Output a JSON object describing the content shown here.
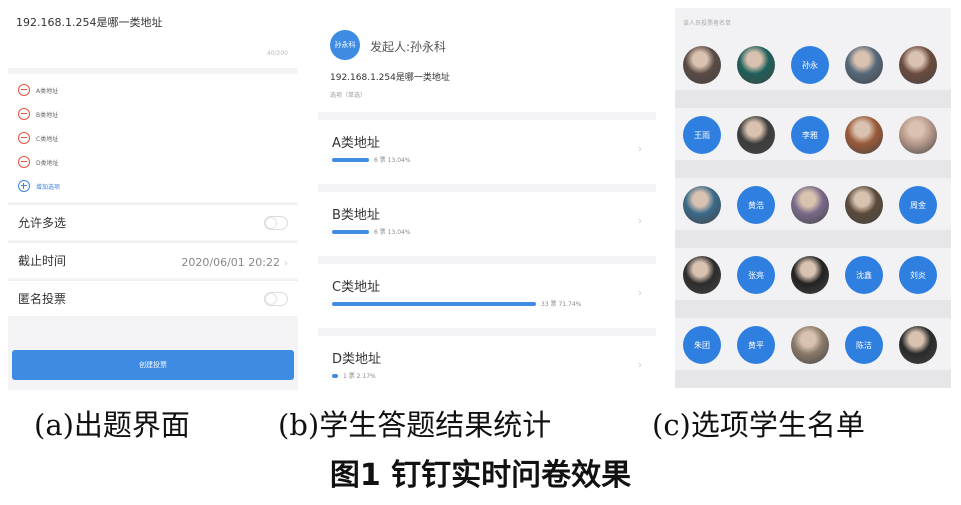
{
  "panel_a": {
    "question_title": "192.168.1.254是哪一类地址",
    "question_count": "40/200",
    "options": [
      "A类地址",
      "B类地址",
      "C类地址",
      "D类地址"
    ],
    "add_option": "增加选项",
    "settings": {
      "multi_select_label": "允许多选",
      "deadline_label": "截止时间",
      "deadline_value": "2020/06/01 20:22",
      "anonymous_label": "匿名投票"
    },
    "create_button": "创建投票"
  },
  "panel_b": {
    "avatar_text": "孙永科",
    "initiator": "发起人:孙永科",
    "question_title": "192.168.1.254是哪一类地址",
    "question_type": "选项（单选）",
    "results": [
      {
        "label": "A类地址",
        "votes": "6 票",
        "percent": "13.04%",
        "fraction": 0.13
      },
      {
        "label": "B类地址",
        "votes": "6 票",
        "percent": "13.04%",
        "fraction": 0.13
      },
      {
        "label": "C类地址",
        "votes": "33 票",
        "percent": "71.74%",
        "fraction": 0.72
      },
      {
        "label": "D类地址",
        "votes": "1 票",
        "percent": "2.17%",
        "fraction": 0.02
      }
    ]
  },
  "panel_c": {
    "header": "该人员投票者名单",
    "rows": [
      [
        {
          "photo": "#5a4a44"
        },
        {
          "photo": "#1e5f5a"
        },
        {
          "name": "孙永"
        },
        {
          "photo": "#55687a"
        },
        {
          "photo": "#6b4b3e"
        }
      ],
      [
        {
          "name": "王雨"
        },
        {
          "photo": "#3c3c3c"
        },
        {
          "name": "李雅"
        },
        {
          "photo": "#9a5a3a"
        },
        {
          "photo": "#b89a8c"
        }
      ],
      [
        {
          "photo": "#3a6a8a"
        },
        {
          "name": "黄浩"
        },
        {
          "photo": "#7a6a8a"
        },
        {
          "photo": "#5a4a3a"
        },
        {
          "name": "周金"
        }
      ],
      [
        {
          "photo": "#2c2c2c"
        },
        {
          "name": "张亮"
        },
        {
          "photo": "#222222"
        },
        {
          "name": "沈鑫"
        },
        {
          "name": "刘炎"
        }
      ],
      [
        {
          "name": "朱团"
        },
        {
          "name": "黄平"
        },
        {
          "photo": "#8a7a6a"
        },
        {
          "name": "陈洁"
        },
        {
          "photo": "#2a2a2a"
        }
      ]
    ]
  },
  "captions": {
    "a": "(a)出题界面",
    "b": "(b)学生答题结果统计",
    "c": "(c)选项学生名单",
    "figure_title": "图1  钉钉实时问卷效果"
  },
  "colors": {
    "accent": "#3d8be3",
    "remove": "#e5533c"
  }
}
